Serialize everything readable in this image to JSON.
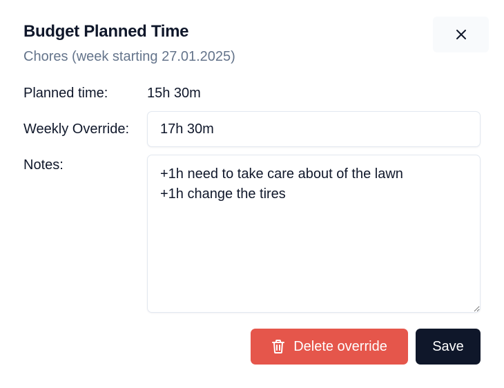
{
  "dialog": {
    "title": "Budget Planned Time",
    "subtitle": "Chores (week starting 27.01.2025)",
    "close_icon": "x-icon"
  },
  "form": {
    "planned_time_label": "Planned time:",
    "planned_time_value": "15h 30m",
    "weekly_override_label": "Weekly Override:",
    "weekly_override_value": "17h 30m",
    "notes_label": "Notes:",
    "notes_value": "+1h need to take care about of the lawn\n+1h change the tires"
  },
  "actions": {
    "delete_label": "Delete override",
    "delete_icon": "trash-icon",
    "save_label": "Save"
  },
  "colors": {
    "primary": "#0f172a",
    "danger": "#e5564b",
    "muted_text": "#64748b"
  }
}
